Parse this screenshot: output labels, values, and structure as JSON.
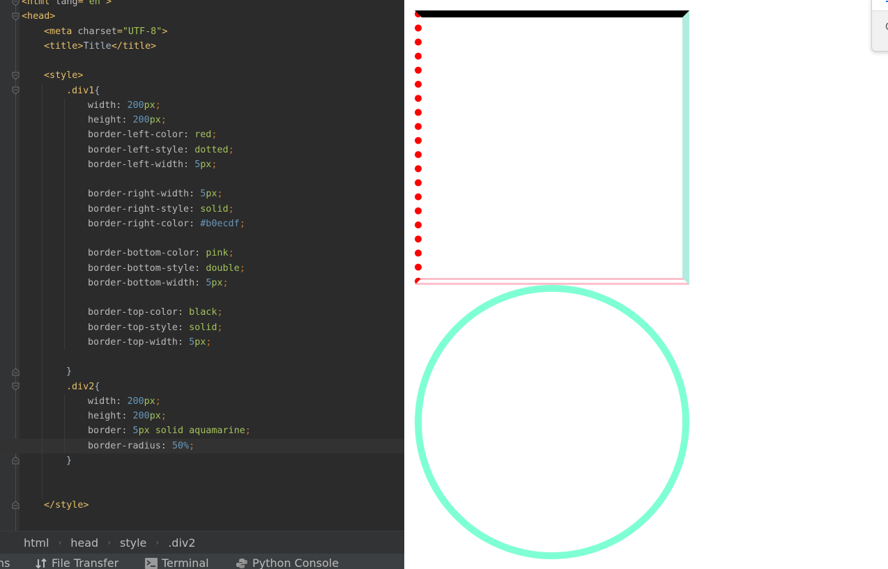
{
  "editor": {
    "lines": [
      [
        {
          "c": "t-tag",
          "t": "<html "
        },
        {
          "c": "t-attr",
          "t": "lang"
        },
        {
          "c": "t-tag",
          "t": "="
        },
        {
          "c": "t-val",
          "t": "\"en\""
        },
        {
          "c": "t-tag",
          "t": ">"
        }
      ],
      [
        {
          "c": "t-tag",
          "t": "<head>"
        }
      ],
      [
        {
          "c": "t-tag",
          "t": "<meta "
        },
        {
          "c": "t-attr",
          "t": "charset"
        },
        {
          "c": "t-tag",
          "t": "="
        },
        {
          "c": "t-val",
          "t": "\"UTF-8\""
        },
        {
          "c": "t-tag",
          "t": ">"
        }
      ],
      [
        {
          "c": "t-tag",
          "t": "<title>"
        },
        {
          "c": "t-text",
          "t": "Title"
        },
        {
          "c": "t-tag",
          "t": "</title>"
        }
      ],
      [],
      [
        {
          "c": "t-tag",
          "t": "<style>"
        }
      ],
      [
        {
          "c": "t-sel",
          "t": ".div1"
        },
        {
          "c": "t-brace",
          "t": "{"
        }
      ],
      [
        {
          "c": "t-prop",
          "t": "width: "
        },
        {
          "c": "t-num",
          "t": "200"
        },
        {
          "c": "t-unit",
          "t": "px"
        },
        {
          "c": "t-punc",
          "t": ";"
        }
      ],
      [
        {
          "c": "t-prop",
          "t": "height: "
        },
        {
          "c": "t-num",
          "t": "200"
        },
        {
          "c": "t-unit",
          "t": "px"
        },
        {
          "c": "t-punc",
          "t": ";"
        }
      ],
      [
        {
          "c": "t-prop",
          "t": "border-left-color: "
        },
        {
          "c": "t-kw",
          "t": "red"
        },
        {
          "c": "t-punc",
          "t": ";"
        }
      ],
      [
        {
          "c": "t-prop",
          "t": "border-left-style: "
        },
        {
          "c": "t-kw",
          "t": "dotted"
        },
        {
          "c": "t-punc",
          "t": ";"
        }
      ],
      [
        {
          "c": "t-prop",
          "t": "border-left-width: "
        },
        {
          "c": "t-num",
          "t": "5"
        },
        {
          "c": "t-unit",
          "t": "px"
        },
        {
          "c": "t-punc",
          "t": ";"
        }
      ],
      [],
      [
        {
          "c": "t-prop",
          "t": "border-right-width: "
        },
        {
          "c": "t-num",
          "t": "5"
        },
        {
          "c": "t-unit",
          "t": "px"
        },
        {
          "c": "t-punc",
          "t": ";"
        }
      ],
      [
        {
          "c": "t-prop",
          "t": "border-right-style: "
        },
        {
          "c": "t-kw",
          "t": "solid"
        },
        {
          "c": "t-punc",
          "t": ";"
        }
      ],
      [
        {
          "c": "t-prop",
          "t": "border-right-color: "
        },
        {
          "c": "t-num",
          "t": "#b0ecdf"
        },
        {
          "c": "t-punc",
          "t": ";"
        }
      ],
      [],
      [
        {
          "c": "t-prop",
          "t": "border-bottom-color: "
        },
        {
          "c": "t-kw",
          "t": "pink"
        },
        {
          "c": "t-punc",
          "t": ";"
        }
      ],
      [
        {
          "c": "t-prop",
          "t": "border-bottom-style: "
        },
        {
          "c": "t-kw",
          "t": "double"
        },
        {
          "c": "t-punc",
          "t": ";"
        }
      ],
      [
        {
          "c": "t-prop",
          "t": "border-bottom-width: "
        },
        {
          "c": "t-num",
          "t": "5"
        },
        {
          "c": "t-unit",
          "t": "px"
        },
        {
          "c": "t-punc",
          "t": ";"
        }
      ],
      [],
      [
        {
          "c": "t-prop",
          "t": "border-top-color: "
        },
        {
          "c": "t-kw",
          "t": "black"
        },
        {
          "c": "t-punc",
          "t": ";"
        }
      ],
      [
        {
          "c": "t-prop",
          "t": "border-top-style: "
        },
        {
          "c": "t-kw",
          "t": "solid"
        },
        {
          "c": "t-punc",
          "t": ";"
        }
      ],
      [
        {
          "c": "t-prop",
          "t": "border-top-width: "
        },
        {
          "c": "t-num",
          "t": "5"
        },
        {
          "c": "t-unit",
          "t": "px"
        },
        {
          "c": "t-punc",
          "t": ";"
        }
      ],
      [],
      [
        {
          "c": "t-brace",
          "t": "}"
        }
      ],
      [
        {
          "c": "t-sel",
          "t": ".div2"
        },
        {
          "c": "t-brace",
          "t": "{"
        }
      ],
      [
        {
          "c": "t-prop",
          "t": "width: "
        },
        {
          "c": "t-num",
          "t": "200"
        },
        {
          "c": "t-unit",
          "t": "px"
        },
        {
          "c": "t-punc",
          "t": ";"
        }
      ],
      [
        {
          "c": "t-prop",
          "t": "height: "
        },
        {
          "c": "t-num",
          "t": "200"
        },
        {
          "c": "t-unit",
          "t": "px"
        },
        {
          "c": "t-punc",
          "t": ";"
        }
      ],
      [
        {
          "c": "t-prop",
          "t": "border: "
        },
        {
          "c": "t-num",
          "t": "5"
        },
        {
          "c": "t-unit",
          "t": "px "
        },
        {
          "c": "t-kw",
          "t": "solid aquamarine"
        },
        {
          "c": "t-punc",
          "t": ";"
        }
      ],
      [
        {
          "c": "t-prop",
          "t": "border-radius: "
        },
        {
          "c": "t-num",
          "t": "50%"
        },
        {
          "c": "t-punc",
          "t": ";"
        }
      ],
      [
        {
          "c": "t-brace",
          "t": "}"
        }
      ],
      [],
      [],
      [
        {
          "c": "t-tag",
          "t": "</style>"
        }
      ],
      []
    ],
    "indents": [
      0,
      0,
      1,
      1,
      0,
      1,
      2,
      3,
      3,
      3,
      3,
      3,
      0,
      3,
      3,
      3,
      0,
      3,
      3,
      3,
      0,
      3,
      3,
      3,
      0,
      2,
      2,
      3,
      3,
      3,
      3,
      2,
      0,
      0,
      1,
      0
    ],
    "current_line": 30
  },
  "breadcrumb": [
    "html",
    "head",
    "style",
    ".div2"
  ],
  "toolbar": {
    "partial_left": "ns",
    "items": [
      {
        "label": "File Transfer",
        "icon": "transfer-icon"
      },
      {
        "label": "Terminal",
        "icon": "terminal-icon"
      },
      {
        "label": "Python Console",
        "icon": "python-icon"
      }
    ]
  },
  "preview": {
    "div1": {
      "left_color": "#ff0000",
      "right_color": "#b0ecdf",
      "bottom_color": "#ffc0cb",
      "top_color": "#000000"
    },
    "div2": {
      "border_color": "#7fffd4"
    },
    "popup_glyph": "C"
  }
}
